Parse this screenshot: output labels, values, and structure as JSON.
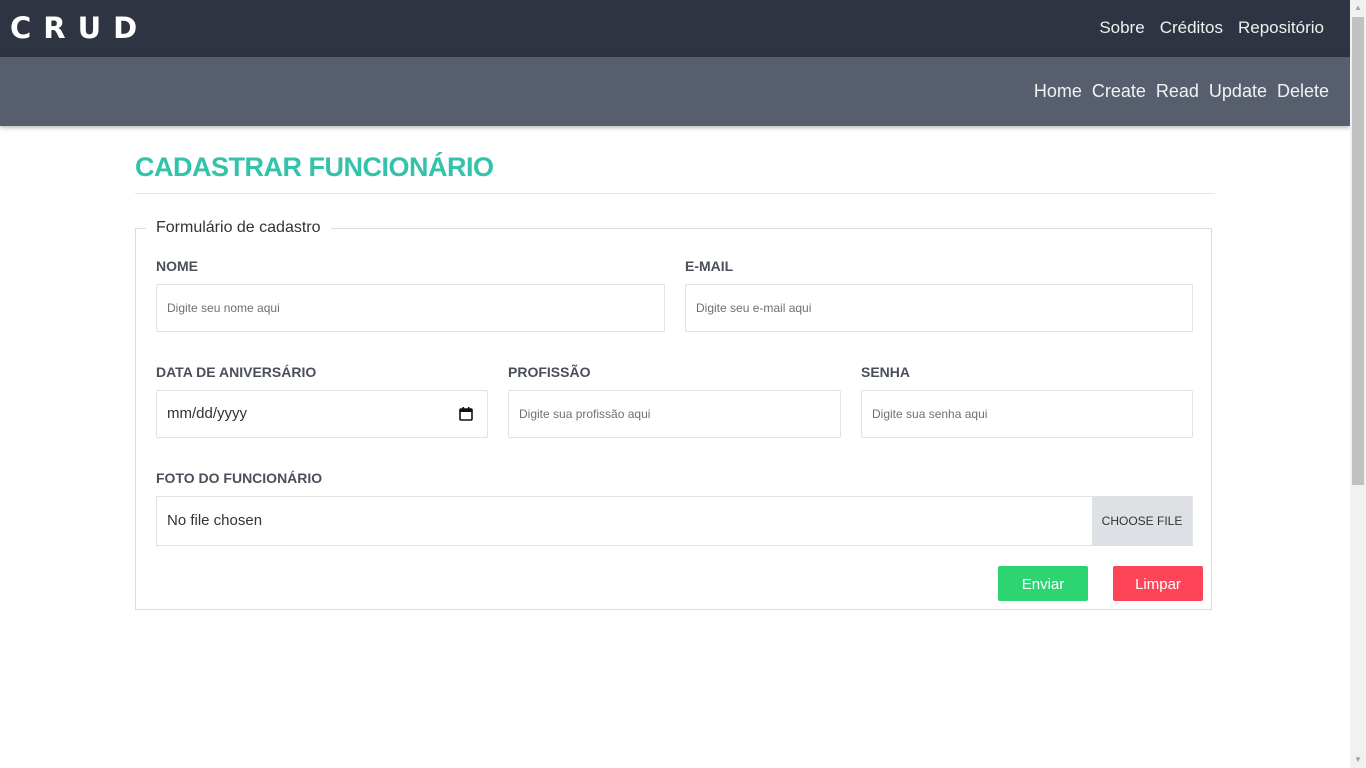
{
  "brand": "CRUD",
  "top_nav": [
    "Sobre",
    "Créditos",
    "Repositório"
  ],
  "sub_nav": [
    "Home",
    "Create",
    "Read",
    "Update",
    "Delete"
  ],
  "page": {
    "title": "CADASTRAR FUNCIONÁRIO"
  },
  "form": {
    "legend": "Formulário de cadastro",
    "nome": {
      "label": "NOME",
      "placeholder": "Digite seu nome aqui"
    },
    "email": {
      "label": "E-MAIL",
      "placeholder": "Digite seu e-mail aqui"
    },
    "aniversario": {
      "label": "DATA DE ANIVERSÁRIO",
      "value": "mm/dd/yyyy",
      "icon": "calendar-icon"
    },
    "profissao": {
      "label": "PROFISSÃO",
      "placeholder": "Digite sua profissão aqui"
    },
    "senha": {
      "label": "SENHA",
      "placeholder": "Digite sua senha aqui"
    },
    "foto": {
      "label": "FOTO DO FUNCIONÁRIO",
      "status": "No file chosen",
      "button": "CHOOSE FILE"
    },
    "submit": "Enviar",
    "reset": "Limpar"
  },
  "colors": {
    "topbar": "#2e3442",
    "subbar": "#575f6e",
    "title": "#33c2aa",
    "submit": "#2dd572",
    "reset": "#fe4459"
  }
}
